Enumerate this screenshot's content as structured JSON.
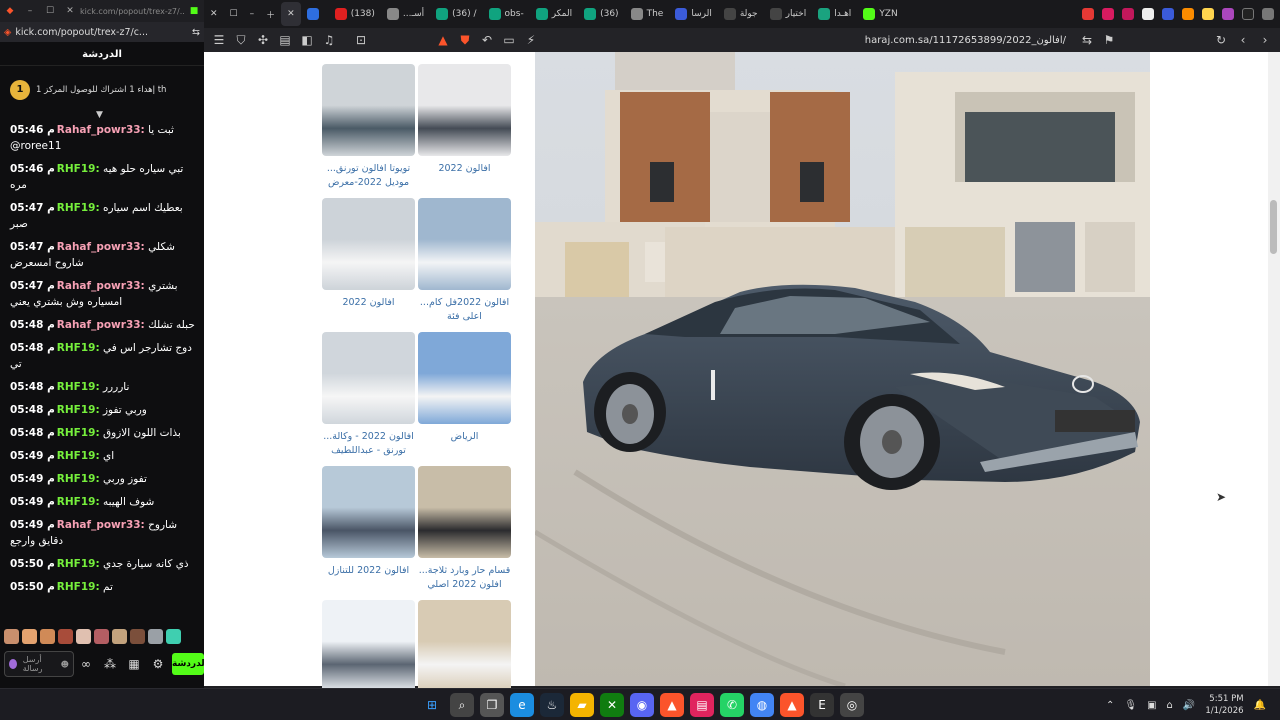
{
  "chat_window": {
    "titlebar_title": "kick.com/popout/trex-z7/...",
    "url": "kick.com/popout/trex-z7/c...",
    "header": "الدردشة",
    "pinned_badge": "1",
    "pinned_text": "إهداء 1 اشتراك للوصول المركز 1 th",
    "messages": [
      {
        "time": "05:46 م",
        "user": "Rahaf_powr33:",
        "color": "#f7a1b5",
        "text": "ثبت يا @roree11"
      },
      {
        "time": "05:46 م",
        "user": "RHF19:",
        "color": "#76f03c",
        "text": "تبي سياره حلو هيه مره"
      },
      {
        "time": "05:47 م",
        "user": "RHF19:",
        "color": "#76f03c",
        "text": "بعطيك اسم سياره صبر"
      },
      {
        "time": "05:47 م",
        "user": "Rahaf_powr33:",
        "color": "#f7a1b5",
        "text": "شكلي شاروح امسعرض"
      },
      {
        "time": "05:47 م",
        "user": "Rahaf_powr33:",
        "color": "#f7a1b5",
        "text": "بشتري امسياره وش بشتري يعني"
      },
      {
        "time": "05:48 م",
        "user": "Rahaf_powr33:",
        "color": "#f7a1b5",
        "text": "حبله تشلك"
      },
      {
        "time": "05:48 م",
        "user": "RHF19:",
        "color": "#76f03c",
        "text": "دوج تشارجر اس في تي"
      },
      {
        "time": "05:48 م",
        "user": "RHF19:",
        "color": "#76f03c",
        "text": "نارررر"
      },
      {
        "time": "05:48 م",
        "user": "RHF19:",
        "color": "#76f03c",
        "text": "وربي تفوز"
      },
      {
        "time": "05:48 م",
        "user": "RHF19:",
        "color": "#76f03c",
        "text": "بذات اللون الازوق"
      },
      {
        "time": "05:49 م",
        "user": "RHF19:",
        "color": "#76f03c",
        "text": "اي"
      },
      {
        "time": "05:49 م",
        "user": "RHF19:",
        "color": "#76f03c",
        "text": "تفوز وربي"
      },
      {
        "time": "05:49 م",
        "user": "RHF19:",
        "color": "#76f03c",
        "text": "شوف الهيبه"
      },
      {
        "time": "05:49 م",
        "user": "Rahaf_powr33:",
        "color": "#f7a1b5",
        "text": "شاروح دقايق وارجع"
      },
      {
        "time": "05:50 م",
        "user": "RHF19:",
        "color": "#76f03c",
        "text": "ذي كانه سيارة جدي"
      },
      {
        "time": "05:50 م",
        "user": "RHF19:",
        "color": "#76f03c",
        "text": "تم"
      }
    ],
    "input_placeholder": "أرسل رسالة",
    "send_label": "الدردشة"
  },
  "browser": {
    "tabs": [
      {
        "label": "",
        "color": "#2e6ee0"
      },
      {
        "label": "(138)",
        "color": "#e02020"
      },
      {
        "label": "...أسـ",
        "color": "#888"
      },
      {
        "label": "(36) /",
        "color": "#10a37f"
      },
      {
        "label": "obs-",
        "color": "#10a37f"
      },
      {
        "label": "المكر",
        "color": "#10a37f"
      },
      {
        "label": "(36)",
        "color": "#10a37f"
      },
      {
        "label": "The",
        "color": "#888"
      },
      {
        "label": "الرسا",
        "color": "#3b5bd9"
      },
      {
        "label": "جولة",
        "color": "#444"
      },
      {
        "label": "اختيار",
        "color": "#444"
      },
      {
        "label": "اهـدا",
        "color": "#1aa37f"
      },
      {
        "label": "YZN",
        "color": "#53fc18"
      }
    ],
    "address": "haraj.com.sa/11172653899/2022_افالون/",
    "listings": [
      {
        "caption": "افالون 2022",
        "colors": [
          "#e8e8ea",
          "#444b55"
        ]
      },
      {
        "caption": "تويوتا افالون تورنق... موديل 2022-معرض",
        "colors": [
          "#cfd4d8",
          "#4a5a66"
        ]
      },
      {
        "caption": "افالون 2022فل كام... اعلى فئة",
        "colors": [
          "#9fb7cf",
          "#f2f4f6"
        ]
      },
      {
        "caption": "افالون 2022",
        "colors": [
          "#cdd3d9",
          "#f5f5f5"
        ]
      },
      {
        "caption": "الرياض",
        "colors": [
          "#7fa8d8",
          "#f4f4f4"
        ]
      },
      {
        "caption": "افالون 2022 - وكالة... تورنق - عبداللطيف",
        "colors": [
          "#d0d6dc",
          "#f6f6f6"
        ]
      },
      {
        "caption": "قسام حار وبارد ثلاجة... افلون 2022 اصلي",
        "colors": [
          "#c8bda8",
          "#2b2b2e"
        ]
      },
      {
        "caption": "افالون 2022 للتنازل",
        "colors": [
          "#b7c9d8",
          "#4a5566"
        ]
      },
      {
        "caption": "",
        "colors": [
          "#d8cbb4",
          "#f4f4f4"
        ]
      },
      {
        "caption": "",
        "colors": [
          "#eef2f6",
          "#5b6572"
        ]
      }
    ]
  },
  "taskbar": {
    "time": "5:51 PM",
    "date": "1/1/2026",
    "apps": [
      "windows-start",
      "search",
      "task-view",
      "edge",
      "steam",
      "file-explorer",
      "xbox",
      "discord",
      "brave",
      "news",
      "whatsapp",
      "chrome",
      "brave-active",
      "epic",
      "obs"
    ]
  }
}
